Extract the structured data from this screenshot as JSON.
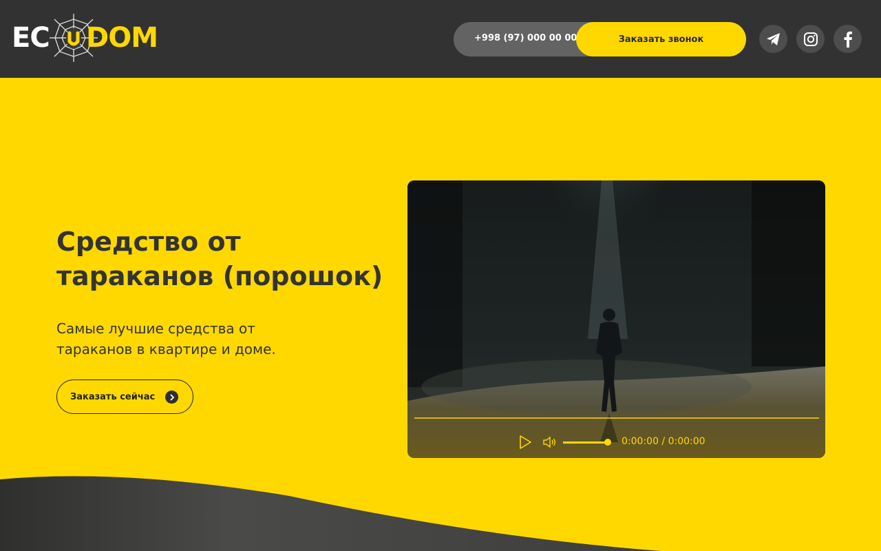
{
  "header": {
    "logo": {
      "part1": "EC",
      "part2": "DOM"
    },
    "phone": "+998 (97) 000 00 00",
    "call_button": "Заказать звонок",
    "socials": [
      "telegram-icon",
      "instagram-icon",
      "facebook-icon"
    ]
  },
  "hero": {
    "title": "Средство от тараканов (порошок)",
    "subtitle": "Самые лучшие средства от тараканов в квартире и доме.",
    "order_button": "Заказать сейчас"
  },
  "video": {
    "time": "0:00:00 / 0:00:00",
    "progress": 0,
    "volume": 1.0,
    "icons": [
      "play-icon",
      "volume-icon"
    ]
  },
  "colors": {
    "accent": "#FFD800",
    "dark": "#323232",
    "text": "#333333"
  }
}
